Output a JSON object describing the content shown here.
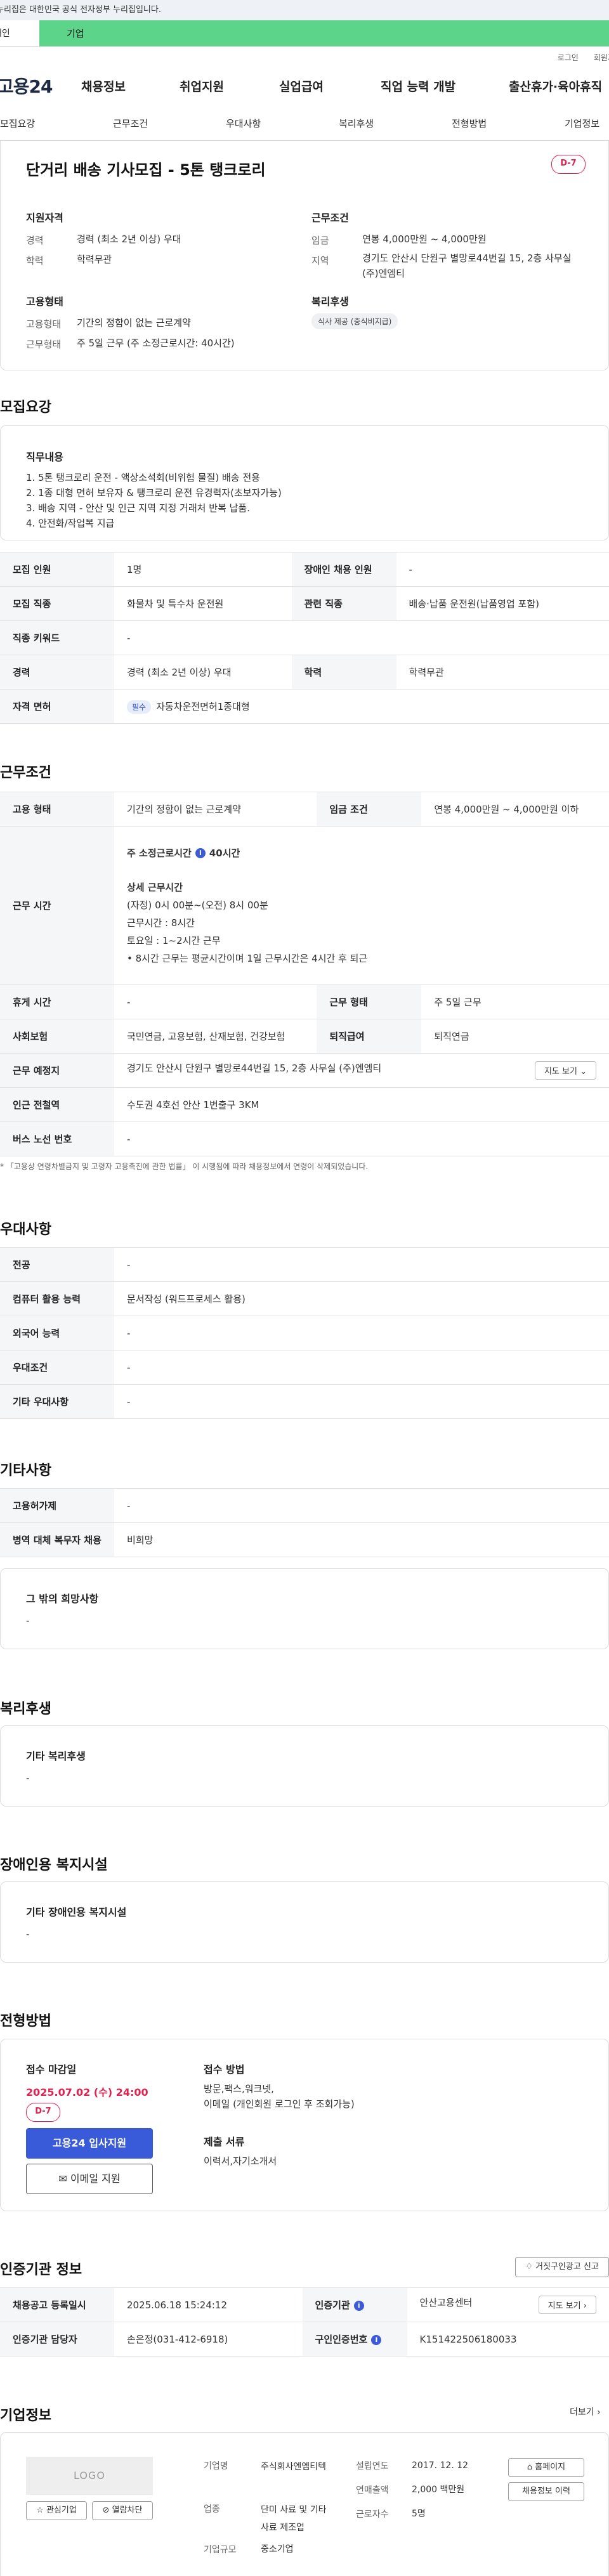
{
  "gov_banner": "이 누리집은 대한민국 공식 전자정부 누리집입니다.",
  "top_tabs": {
    "left": "개인",
    "right": "기업"
  },
  "util_links": [
    "로그인",
    "회원가입"
  ],
  "site": {
    "logo": "고용24"
  },
  "gnb": [
    "채용정보",
    "취업지원",
    "실업급여",
    "직업 능력 개발",
    "출산휴가·육아휴직"
  ],
  "lnb": [
    "모집요강",
    "근무조건",
    "우대사항",
    "복리후생",
    "전형방법",
    "기업정보"
  ],
  "job": {
    "title": "단거리 배송 기사모집 - 5톤 탱크로리",
    "dday": "D-7",
    "qual_head": "지원자격",
    "qual": [
      {
        "k": "경력",
        "v": "경력 (최소 2년 이상) 우대"
      },
      {
        "k": "학력",
        "v": "학력무관"
      }
    ],
    "cond_head": "근무조건",
    "cond": [
      {
        "k": "임금",
        "v": "연봉 4,000만원 ~ 4,000만원"
      },
      {
        "k": "지역",
        "v": "경기도 안산시 단원구 별망로44번길 15, 2층 사무실 (주)엔엠티"
      }
    ],
    "emp_head": "고용형태",
    "emp": [
      {
        "k": "고용형태",
        "v": "기간의 정함이 없는 근로계약"
      },
      {
        "k": "근무형태",
        "v": "주 5일 근무 (주 소정근로시간: 40시간)"
      }
    ],
    "welfare_head": "복리후생",
    "welfare_chip": "식사 제공 (중식비지급)"
  },
  "recruit": {
    "section_title": "모집요강",
    "duty_title": "직무내용",
    "duty_lines": [
      "1. 5톤 탱크로리 운전 - 액상소석회(비위험 물질) 배송 전용",
      "2. 1종 대형 면허 보유자 & 탱크로리 운전 유경력자(초보자가능)",
      "3. 배송 지역 - 안산 및 인근 지역 지정 거래처 반복 납품.",
      "4. 안전화/작업복 지급"
    ],
    "rows": [
      {
        "k1": "모집 인원",
        "v1": "1명",
        "k2": "장애인 채용 인원",
        "v2": "-"
      },
      {
        "k1": "모집 직종",
        "v1": "화물차 및 특수차 운전원",
        "k2": "관련 직종",
        "v2": "배송·납품 운전원(납품영업 포함)"
      },
      {
        "k1": "직종 키워드",
        "v1": "-"
      },
      {
        "k1": "경력",
        "v1": "경력 (최소 2년 이상) 우대",
        "k2": "학력",
        "v2": "학력무관"
      },
      {
        "k1": "자격 면허",
        "badge": "필수",
        "v1": "자동차운전면허1종대형"
      }
    ]
  },
  "work": {
    "section_title": "근무조건",
    "employ_type_k": "고용 형태",
    "employ_type_v": "기간의 정함이 없는 근로계약",
    "wage_k": "임금 조건",
    "wage_v": "연봉 4,000만원 ~ 4,000만원 이하",
    "hours_k": "근무 시간",
    "hours_weekly": "주 소정근로시간",
    "hours_weekly_v": "40시간",
    "hours_detail_title": "상세 근무시간",
    "hours_detail": [
      "(자정) 0시 00분~(오전) 8시 00분",
      "근무시간 : 8시간",
      "토요일 : 1~2시간 근무",
      "• 8시간 근무는 평균시간이며 1일 근무시간은 4시간 후 퇴근"
    ],
    "rows": [
      {
        "k1": "휴게 시간",
        "v1": "-",
        "k2": "근무 형태",
        "v2": "주 5일 근무"
      },
      {
        "k1": "사회보험",
        "v1": "국민연금, 고용보험, 산재보험, 건강보험",
        "k2": "퇴직급여",
        "v2": "퇴직연금"
      }
    ],
    "place_k": "근무 예정지",
    "place_v": "경기도 안산시 단원구 별망로44번길 15, 2층 사무실 (주)엔엠티",
    "map_btn": "지도 보기",
    "station_k": "인근 전철역",
    "station_v": "수도권 4호선 안산 1번출구 3KM",
    "bus_k": "버스 노선 번호",
    "bus_v": "-",
    "note": "* 「고용상 연령차별금지 및 고령자 고용촉진에 관한 법률」 이 시행됨에 따라 채용정보에서 연령이 삭제되었습니다."
  },
  "prefer": {
    "section_title": "우대사항",
    "rows": [
      {
        "k": "전공",
        "v": "-"
      },
      {
        "k": "컴퓨터 활용 능력",
        "v": "문서작성 (워드프로세스 활용)"
      },
      {
        "k": "외국어 능력",
        "v": "-"
      },
      {
        "k": "우대조건",
        "v": "-"
      },
      {
        "k": "기타 우대사항",
        "v": "-"
      }
    ]
  },
  "etc": {
    "section_title": "기타사항",
    "rows": [
      {
        "k": "고용허가제",
        "v": "-"
      },
      {
        "k": "병역 대체 복무자 채용",
        "v": "비희망"
      }
    ],
    "box_title": "그 밖의 희망사항",
    "box_value": "-"
  },
  "welfare": {
    "section_title": "복리후생",
    "box_title": "기타 복리후생",
    "box_value": "-"
  },
  "disabled": {
    "section_title": "장애인용 복지시설",
    "box_title": "기타 장애인용 복지시설",
    "box_value": "-"
  },
  "process": {
    "section_title": "전형방법",
    "deadline_label": "접수 마감일",
    "deadline": "2025.07.02 (수) 24:00",
    "dday": "D-7",
    "apply_btn": "고용24 입사지원",
    "email_btn": "이메일 지원",
    "method_label": "접수 방법",
    "method_lines": [
      "방문,팩스,워크넷,",
      "이메일 (개인회원 로그인 후 조회가능)"
    ],
    "docs_label": "제출 서류",
    "docs_value": "이력서,자기소개서"
  },
  "agency": {
    "section_title": "인증기관 정보",
    "report_btn": "거짓구인광고 신고",
    "rows": [
      {
        "k1": "채용공고 등록일시",
        "v1": "2025.06.18 15:24:12",
        "k2": "인증기관",
        "v2": "안산고용센터",
        "btn": "지도 보기"
      },
      {
        "k1": "인증기관 담당자",
        "v1": "손은정(031-412-6918)",
        "k2": "구인인증번호",
        "v2": "K151422506180033"
      }
    ]
  },
  "company": {
    "section_title": "기업정보",
    "more": "더보기",
    "logo_text": "LOGO",
    "interest_btn": "관심기업",
    "block_btn": "열람차단",
    "fields": [
      {
        "k": "기업명",
        "v": "주식회사엔엠티텍"
      },
      {
        "k": "업종",
        "v": "단미 사료 및 기타 사료 제조업"
      },
      {
        "k": "기업규모",
        "v": "중소기업"
      }
    ],
    "fields2": [
      {
        "k": "설립연도",
        "v": "2017. 12. 12"
      },
      {
        "k": "연매출액",
        "v": "2,000 백만원"
      },
      {
        "k": "근로자수",
        "v": "5명"
      }
    ],
    "homepage_btn": "홈페이지",
    "jobs_btn": "채용정보 이력"
  }
}
